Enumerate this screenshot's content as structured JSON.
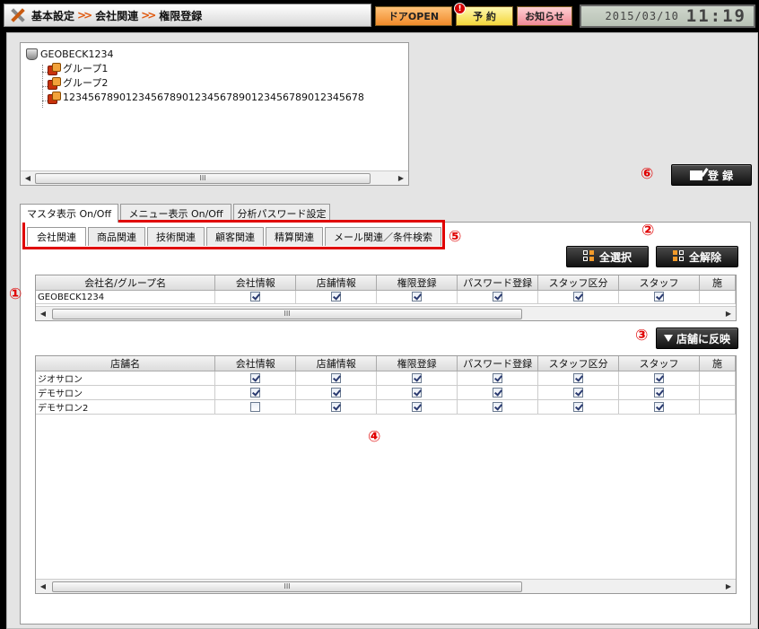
{
  "header": {
    "crumbs": [
      "基本設定",
      "会社関連",
      "権限登録"
    ],
    "sep": ">>",
    "door_label": "ドアOPEN",
    "yoyaku_label": "予 約",
    "yoyaku_alert": "!",
    "news_label": "お知らせ",
    "date": "2015/03/10",
    "time": "11:19"
  },
  "tree": {
    "root": "GEOBECK1234",
    "children": [
      "グループ1",
      "グループ2",
      "123456789012345678901234567890123456789012345678"
    ],
    "scroll_grip": "III"
  },
  "register_label": "登 録",
  "callouts": {
    "c1": "①",
    "c2": "②",
    "c3": "③",
    "c4": "④",
    "c5": "⑤",
    "c6": "⑥"
  },
  "outer_tabs": [
    "マスタ表示 On/Off",
    "メニュー表示 On/Off",
    "分析パスワード設定"
  ],
  "inner_tabs": [
    "会社関連",
    "商品関連",
    "技術関連",
    "顧客関連",
    "精算関連",
    "メール関連／条件検索"
  ],
  "buttons": {
    "select_all": "全選択",
    "deselect_all": "全解除",
    "apply_store": "店舗に反映"
  },
  "company_grid": {
    "headers": [
      "会社名/グループ名",
      "会社情報",
      "店舗情報",
      "権限登録",
      "パスワード登録",
      "スタッフ区分",
      "スタッフ",
      "施"
    ],
    "rows": [
      {
        "name": "GEOBECK1234",
        "checks": [
          true,
          true,
          true,
          true,
          true,
          true
        ]
      }
    ]
  },
  "store_grid": {
    "headers": [
      "店舗名",
      "会社情報",
      "店舗情報",
      "権限登録",
      "パスワード登録",
      "スタッフ区分",
      "スタッフ",
      "施"
    ],
    "rows": [
      {
        "name": "ジオサロン",
        "checks": [
          true,
          true,
          true,
          true,
          true,
          true
        ]
      },
      {
        "name": "デモサロン",
        "checks": [
          true,
          true,
          true,
          true,
          true,
          true
        ]
      },
      {
        "name": "デモサロン2",
        "checks": [
          false,
          true,
          true,
          true,
          true,
          true
        ]
      }
    ]
  },
  "colors": {
    "callout": "#e00000",
    "door": "#f08a2a",
    "yoyaku": "#f3d63a",
    "news": "#f08a96"
  }
}
